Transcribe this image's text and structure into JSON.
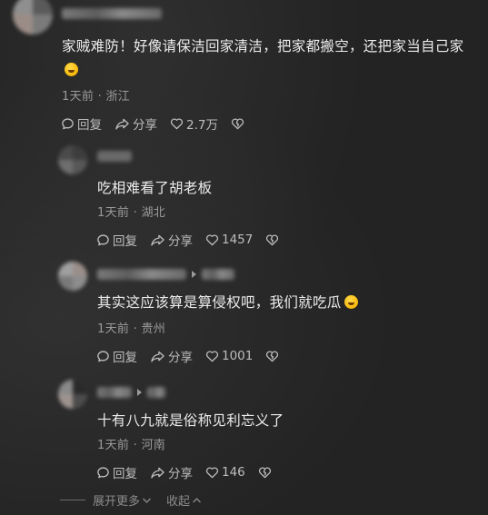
{
  "comments": [
    {
      "text": "家贼难防！好像请保洁回家清洁，把家都搬空，还把家当自己家",
      "emoji_icon": "face-with-tears-of-joy-emoji",
      "time": "1天前",
      "location": "浙江",
      "reply_label": "回复",
      "share_label": "分享",
      "likes": "2.7万"
    },
    {
      "text": "吃相难看了胡老板",
      "time": "1天前",
      "location": "湖北",
      "reply_label": "回复",
      "share_label": "分享",
      "likes": "1457"
    },
    {
      "text": "其实这应该算是算侵权吧，我们就吃瓜",
      "emoji_icon": "rolling-on-floor-laughing-emoji",
      "time": "1天前",
      "location": "贵州",
      "reply_label": "回复",
      "share_label": "分享",
      "likes": "1001"
    },
    {
      "text": "十有八九就是俗称见利忘义了",
      "time": "1天前",
      "location": "河南",
      "reply_label": "回复",
      "share_label": "分享",
      "likes": "146"
    }
  ],
  "meta_separator": "·",
  "footer": {
    "expand_label": "展开更多",
    "collapse_label": "收起"
  },
  "icons": {
    "reply": "reply-bubble-icon",
    "share": "share-arrow-icon",
    "like": "heart-icon",
    "dislike": "broken-heart-icon",
    "expand": "chevron-down-icon",
    "collapse": "chevron-up-icon"
  },
  "colors": {
    "background": "#232323",
    "text": "#ececec",
    "meta": "#9a9a9a",
    "action": "#bdbdbd"
  }
}
